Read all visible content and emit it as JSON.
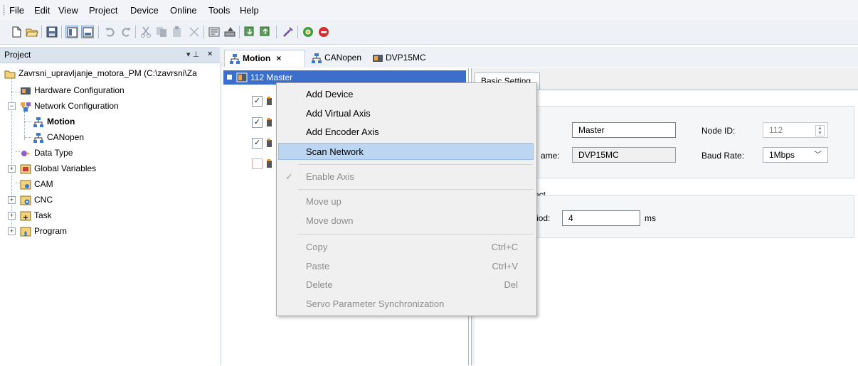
{
  "menubar": {
    "items": [
      "File",
      "Edit",
      "View",
      "Project",
      "Device",
      "Online",
      "Tools",
      "Help"
    ]
  },
  "project_pane": {
    "title": "Project",
    "pin_label": "▾ ⊥",
    "close_label": "×",
    "tree": [
      {
        "label": "Zavrsni_upravljanje_motora_PM (C:\\zavrsni\\Za",
        "icon": "folder-icon"
      },
      {
        "label": "Hardware Configuration",
        "icon": "hardware-icon"
      },
      {
        "label": "Network Configuration",
        "icon": "network-icon"
      },
      {
        "label": "Motion",
        "icon": "network-node-icon",
        "bold": true
      },
      {
        "label": "CANopen",
        "icon": "network-node-icon"
      },
      {
        "label": "Data Type",
        "icon": "datatype-icon"
      },
      {
        "label": "Global Variables",
        "icon": "variables-icon"
      },
      {
        "label": "CAM",
        "icon": "cam-icon"
      },
      {
        "label": "CNC",
        "icon": "cnc-icon"
      },
      {
        "label": "Task",
        "icon": "task-icon"
      },
      {
        "label": "Program",
        "icon": "program-icon"
      }
    ]
  },
  "tabs": [
    {
      "label": "Motion",
      "active": true,
      "close": "×"
    },
    {
      "label": "CANopen",
      "active": false
    },
    {
      "label": "DVP15MC",
      "active": false
    }
  ],
  "device_list": {
    "master_label": "112 Master"
  },
  "properties": {
    "tab_label": "Basic Setting",
    "name_value": "Master",
    "node_id_label": "Node ID:",
    "node_id_value": "112",
    "model_label_partial": "ame:",
    "model_value": "DVP15MC",
    "baud_label": "Baud Rate:",
    "baud_value": "1Mbps",
    "group2_title_partial": "ect",
    "period_label_partial": "iod:",
    "period_value": "4",
    "period_unit": "ms"
  },
  "context_menu": {
    "items": [
      {
        "label": "Add Device",
        "enabled": true
      },
      {
        "label": "Add Virtual Axis",
        "enabled": true
      },
      {
        "label": "Add Encoder Axis",
        "enabled": true
      },
      {
        "label": "Scan Network",
        "enabled": true,
        "highlighted": true
      },
      {
        "label": "Enable Axis",
        "enabled": false,
        "checked": true
      },
      {
        "label": "Move up",
        "enabled": false
      },
      {
        "label": "Move down",
        "enabled": false
      },
      {
        "label": "Copy",
        "shortcut": "Ctrl+C",
        "enabled": false
      },
      {
        "label": "Paste",
        "shortcut": "Ctrl+V",
        "enabled": false
      },
      {
        "label": "Delete",
        "shortcut": "Del",
        "enabled": false
      },
      {
        "label": "Servo Parameter Synchronization",
        "enabled": false
      }
    ]
  },
  "colors": {
    "selection": "#3b6fcb",
    "menu_highlight": "#bcd5f0",
    "disabled_text": "#8c8c8c"
  }
}
